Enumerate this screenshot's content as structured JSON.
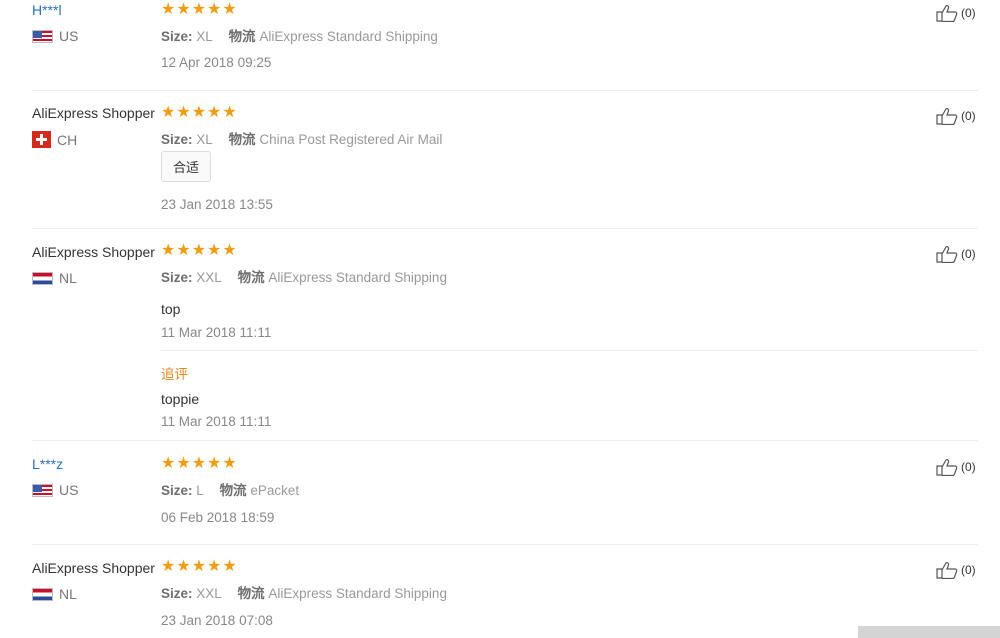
{
  "reviews": [
    {
      "name": "H***l",
      "country": "US",
      "size_label": "Size:",
      "size": "XL",
      "shipping_label": "物流",
      "shipping": "AliExpress Standard Shipping",
      "date": "12 Apr 2018 09:25",
      "likes": "(0)"
    },
    {
      "name": "AliExpress Shopper",
      "country": "CH",
      "size_label": "Size:",
      "size": "XL",
      "shipping_label": "物流",
      "shipping": "China Post Registered Air Mail",
      "tag": "合适",
      "date": "23 Jan 2018 13:55",
      "likes": "(0)"
    },
    {
      "name": "AliExpress Shopper",
      "country": "NL",
      "size_label": "Size:",
      "size": "XXL",
      "shipping_label": "物流",
      "shipping": "AliExpress Standard Shipping",
      "text": "top",
      "date": "11 Mar 2018 11:11",
      "followup_label": "追评",
      "followup_text": "toppie",
      "followup_date": "11 Mar 2018 11:11",
      "likes": "(0)"
    },
    {
      "name": "L***z",
      "country": "US",
      "size_label": "Size:",
      "size": "L",
      "shipping_label": "物流",
      "shipping": "ePacket",
      "date": "06 Feb 2018 18:59",
      "likes": "(0)"
    },
    {
      "name": "AliExpress Shopper",
      "country": "NL",
      "size_label": "Size:",
      "size": "XXL",
      "shipping_label": "物流",
      "shipping": "AliExpress Standard Shipping",
      "date": "23 Jan 2018 07:08",
      "likes": "(0)"
    }
  ],
  "rating": {
    "stars": 5,
    "star_color": "#f39c12"
  },
  "colors": {
    "link": "#2a6fbd",
    "followup": "#e8861a"
  }
}
